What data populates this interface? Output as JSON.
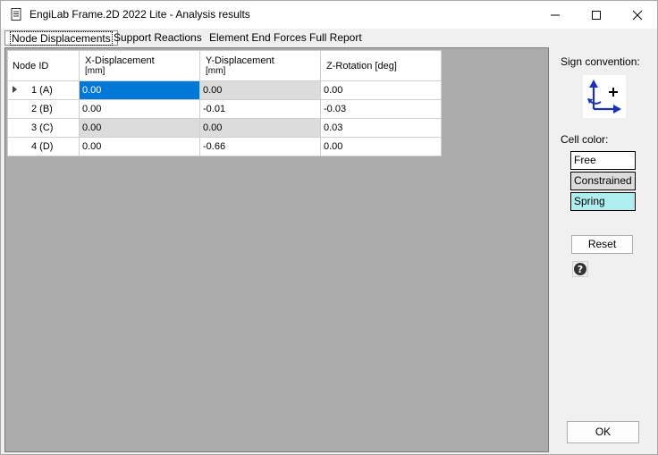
{
  "window": {
    "title": "EngiLab Frame.2D 2022 Lite - Analysis results"
  },
  "tabs": [
    {
      "label": "Node Displacements",
      "active": true
    },
    {
      "label": "Support Reactions",
      "active": false
    },
    {
      "label": "Element End Forces",
      "active": false
    },
    {
      "label": "Full Report",
      "active": false
    }
  ],
  "table": {
    "columns": [
      {
        "main": "Node ID",
        "unit": ""
      },
      {
        "main": "X-Displacement",
        "unit": "[mm]"
      },
      {
        "main": "Y-Displacement",
        "unit": "[mm]"
      },
      {
        "main": "Z-Rotation [deg]",
        "unit": ""
      }
    ],
    "rows": [
      {
        "node": "1 (A)",
        "x": "0.00",
        "y": "0.00",
        "z": "0.00"
      },
      {
        "node": "2 (B)",
        "x": "0.00",
        "y": "-0.01",
        "z": "-0.03"
      },
      {
        "node": "3 (C)",
        "x": "0.00",
        "y": "0.00",
        "z": "0.03"
      },
      {
        "node": "4 (D)",
        "x": "0.00",
        "y": "-0.66",
        "z": "0.00"
      }
    ]
  },
  "panel": {
    "sign_convention_label": "Sign convention:",
    "cell_color_label": "Cell color:",
    "legend": [
      {
        "label": "Free",
        "color": "#ffffff"
      },
      {
        "label": "Constrained",
        "color": "#dcdcdc"
      },
      {
        "label": "Spring",
        "color": "#aeeeee"
      }
    ],
    "reset_label": "Reset",
    "ok_label": "OK"
  },
  "colors": {
    "selection": "#0078d7",
    "grid_background": "#ababab",
    "sign_arrow": "#1a33b3"
  },
  "icons": {
    "app": "document-icon",
    "minimize": "minimize-icon",
    "maximize": "maximize-icon",
    "close": "close-icon",
    "sign": "sign-convention-icon",
    "help": "help-icon"
  }
}
